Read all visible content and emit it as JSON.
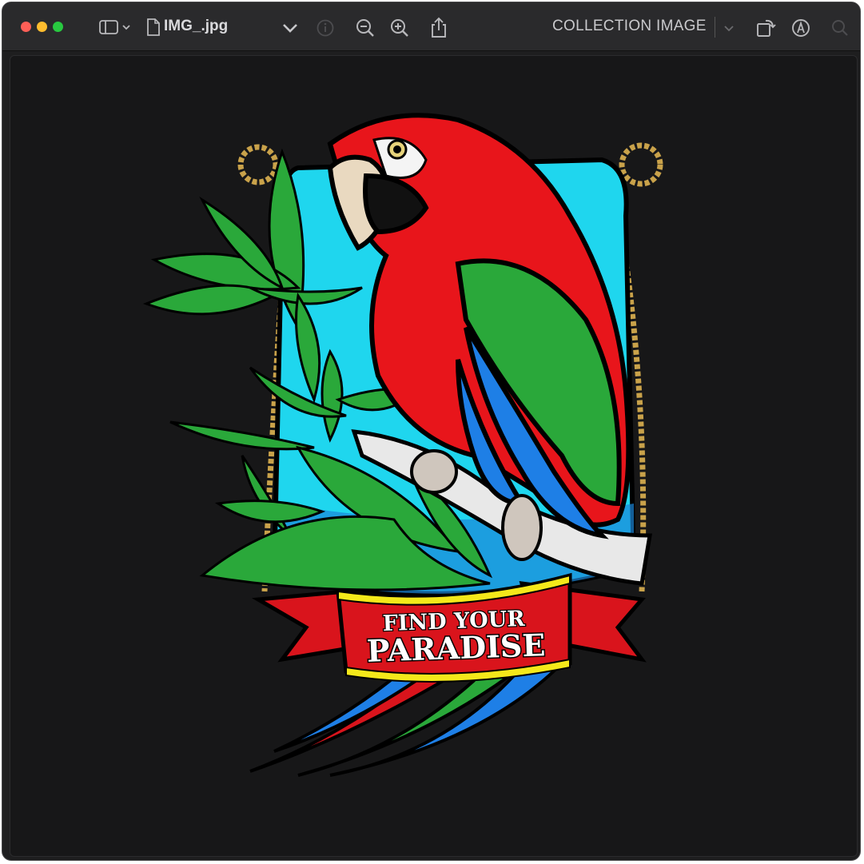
{
  "window": {
    "filename": "IMG_.jpg",
    "collection_label": "COLLECTION IMAGE"
  },
  "toolbar": {
    "icons": [
      "sidebar-icon",
      "chevron-down-icon",
      "document-icon",
      "chevron-down-icon",
      "info-icon",
      "zoom-out-icon",
      "zoom-in-icon",
      "share-icon",
      "chevron-down-icon",
      "rotate-icon",
      "markup-icon",
      "search-icon"
    ]
  },
  "artwork": {
    "banner_line1": "FIND YOUR",
    "banner_line2": "PARADISE",
    "colors": {
      "sky": "#1fd6ee",
      "parrot_red": "#e8151b",
      "leaf_green": "#2aa83a",
      "feather_blue": "#1e7fe6",
      "rope": "#c9a24a",
      "banner_red": "#d9141c",
      "banner_yellow": "#f4e81a"
    }
  }
}
